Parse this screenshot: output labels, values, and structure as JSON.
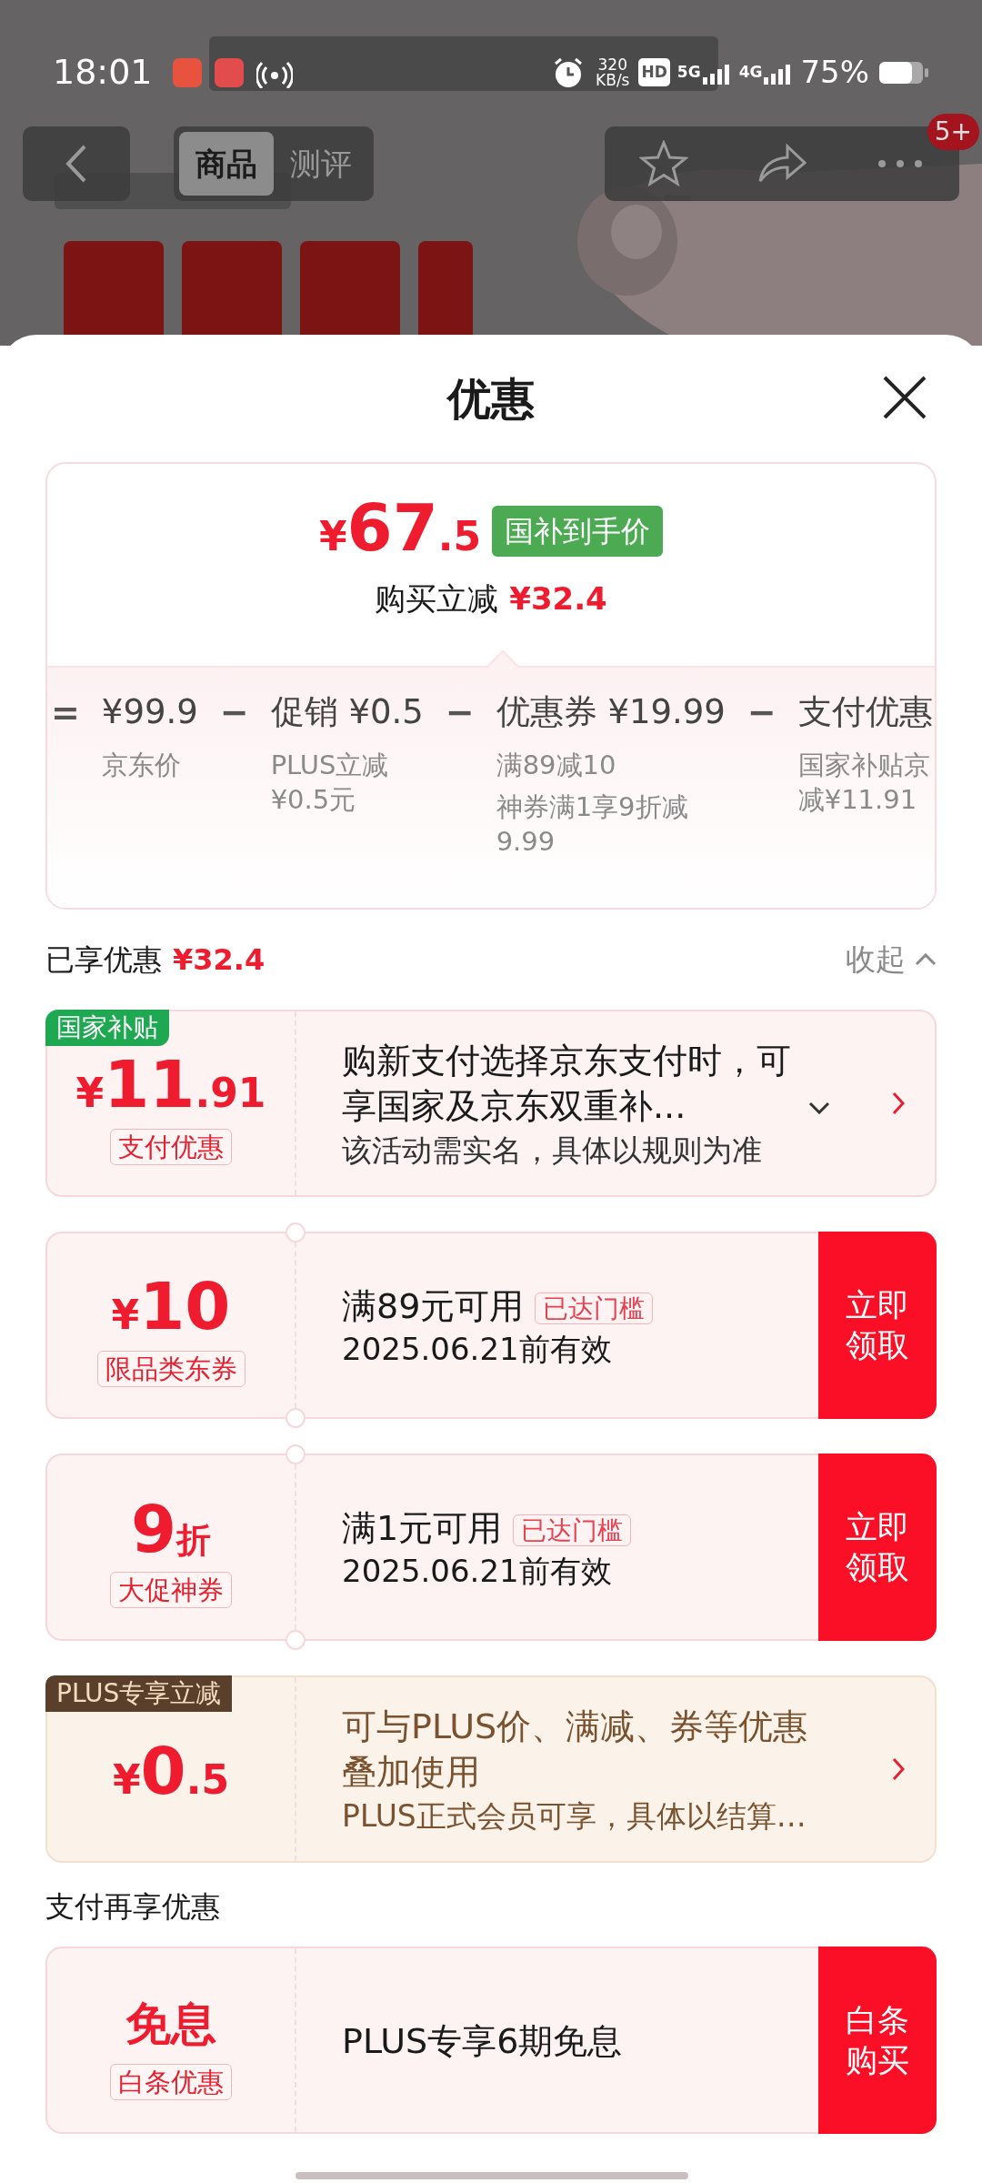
{
  "status_bar": {
    "time": "18:01",
    "speed_value": "320",
    "speed_unit": "KB/s",
    "hd": "HD",
    "network_1": "5G",
    "network_2": "4G",
    "battery_text": "75%"
  },
  "nav": {
    "tabs": [
      {
        "label": "商品",
        "selected": true
      },
      {
        "label": "测评",
        "selected": false
      }
    ],
    "badge": "5+"
  },
  "sheet": {
    "title": "优惠"
  },
  "summary": {
    "price": {
      "currency": "¥",
      "integer": "67",
      "decimal": ".5"
    },
    "price_badge": "国补到手价",
    "saving_label": "购买立减",
    "saving_value": "¥32.4",
    "breakdown": [
      {
        "kind": "operator",
        "text": "="
      },
      {
        "kind": "item",
        "value": "¥99.9",
        "notes": [
          "京东价"
        ]
      },
      {
        "kind": "operator",
        "text": "−"
      },
      {
        "kind": "item",
        "value": "促销 ¥0.5",
        "notes": [
          "PLUS立减¥0.5元"
        ]
      },
      {
        "kind": "operator",
        "text": "−"
      },
      {
        "kind": "item",
        "value": "优惠券 ¥19.99",
        "notes": [
          "满89减10",
          "神券满1享9折减9.99"
        ]
      },
      {
        "kind": "operator",
        "text": "−"
      },
      {
        "kind": "item",
        "value": "支付优惠",
        "notes": [
          "国家补贴京减¥11.91"
        ]
      }
    ]
  },
  "enjoyed": {
    "label": "已享优惠",
    "value": "¥32.4",
    "toggle": "收起"
  },
  "coupons": [
    {
      "kind": "standard",
      "tag": {
        "text": "国家补贴",
        "kind": "subsidy"
      },
      "notched": false,
      "amount": {
        "currency": "¥",
        "integer": "11",
        "decimal": ".91"
      },
      "label": "支付优惠",
      "title": "购新支付选择京东支付时，可享国家及京东双重补...",
      "expandable": true,
      "subtitle": "该活动需实名，具体以规则为准",
      "action": {
        "kind": "chevron"
      }
    },
    {
      "kind": "standard",
      "notched": true,
      "amount": {
        "currency": "¥",
        "integer": "10"
      },
      "label": "限品类东券",
      "title": "满89元可用",
      "title_badge": "已达门槛",
      "date": "2025.06.21前有效",
      "action": {
        "kind": "button",
        "label": "立即领取"
      }
    },
    {
      "kind": "standard",
      "notched": true,
      "amount": {
        "integer": "9",
        "unit": "折"
      },
      "label": "大促神券",
      "title": "满1元可用",
      "title_badge": "已达门槛",
      "date": "2025.06.21前有效",
      "action": {
        "kind": "button",
        "label": "立即领取"
      }
    },
    {
      "kind": "plus",
      "tag": {
        "text": "PLUS专享立减",
        "kind": "plus"
      },
      "notched": false,
      "amount": {
        "currency": "¥",
        "integer": "0",
        "decimal": ".5"
      },
      "title": "可与PLUS价、满减、券等优惠叠加使用",
      "expandable": false,
      "subtitle": "PLUS正式会员可享，具体以结算…",
      "action": {
        "kind": "chevron"
      }
    }
  ],
  "pay_section": {
    "title": "支付再享优惠"
  },
  "pay_coupons": [
    {
      "kind": "standard",
      "notched": false,
      "amount": {
        "word": "免息"
      },
      "label": "白条优惠",
      "title": "PLUS专享6期免息",
      "action": {
        "kind": "button",
        "label": "白条购买"
      }
    }
  ]
}
